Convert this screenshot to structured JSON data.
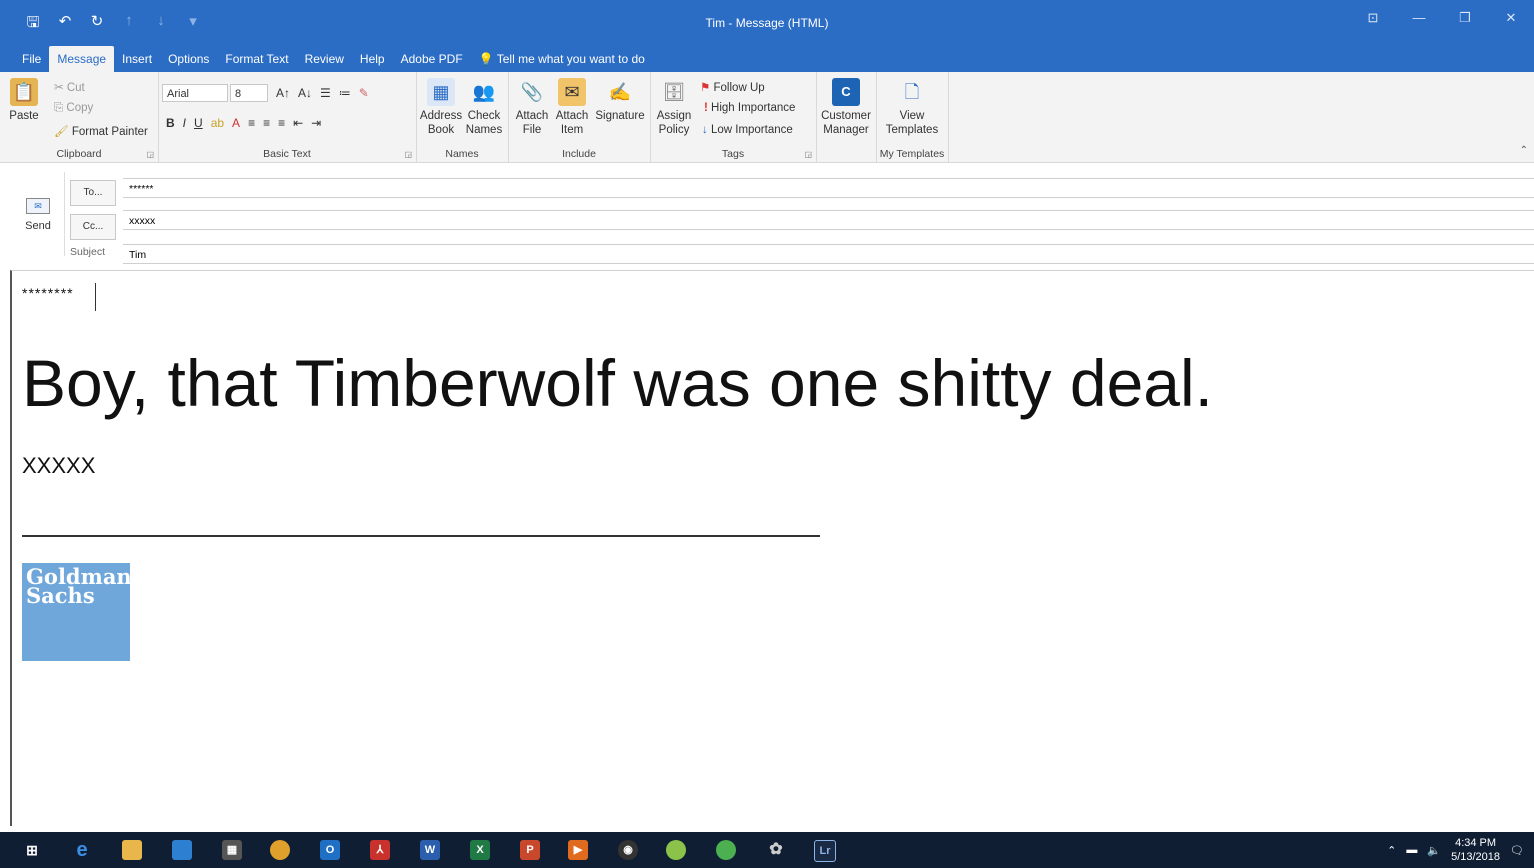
{
  "window": {
    "title": "Tim - Message (HTML)"
  },
  "tabs": [
    "File",
    "Message",
    "Insert",
    "Options",
    "Format Text",
    "Review",
    "Help",
    "Adobe PDF"
  ],
  "tell_me": "Tell me what you want to do",
  "clipboard": {
    "paste": "Paste",
    "cut": "Cut",
    "copy": "Copy",
    "format_painter": "Format Painter",
    "label": "Clipboard"
  },
  "basic_text": {
    "font": "Arial",
    "size": "8",
    "label": "Basic Text"
  },
  "names": {
    "address_book": [
      "Address",
      "Book"
    ],
    "check_names": [
      "Check",
      "Names"
    ],
    "label": "Names"
  },
  "include": {
    "attach_file": [
      "Attach",
      "File"
    ],
    "attach_item": [
      "Attach",
      "Item"
    ],
    "signature": "Signature",
    "label": "Include"
  },
  "tags": {
    "assign_policy": [
      "Assign",
      "Policy"
    ],
    "follow_up": "Follow Up",
    "high_importance": "High Importance",
    "low_importance": "Low Importance",
    "label": "Tags"
  },
  "customer": {
    "label_1": "Customer",
    "label_2": "Manager"
  },
  "templates": {
    "view_1": "View",
    "view_2": "Templates",
    "label": "My Templates"
  },
  "header": {
    "send": "Send",
    "to_button": "To...",
    "cc_button": "Cc...",
    "subject_label": "Subject",
    "to_value": "******",
    "cc_value": "xxxxx",
    "subject_value": "Tim"
  },
  "body": {
    "salutation": "********",
    "main_text": "Boy, that Timberwolf was one shitty deal.",
    "signature": "XXXXX",
    "logo_line1": "Goldman",
    "logo_line2": "Sachs"
  },
  "taskbar": {
    "time": "4:34 PM",
    "date": "5/13/2018"
  }
}
